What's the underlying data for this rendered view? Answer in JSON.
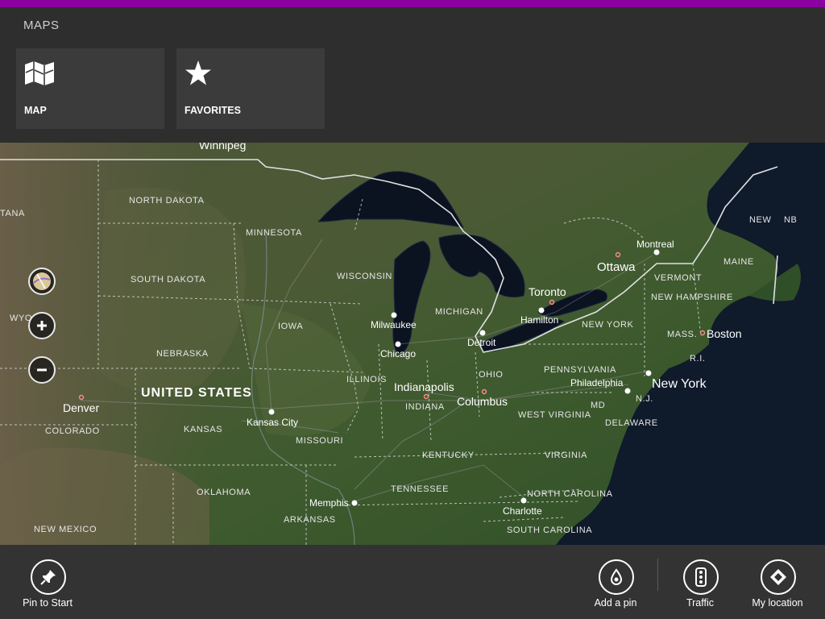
{
  "app": {
    "title": "MAPS",
    "accent_color": "#8b00a0"
  },
  "tiles": [
    {
      "label": "MAP",
      "icon": "map-icon"
    },
    {
      "label": "FAVORITES",
      "icon": "star-icon"
    }
  ],
  "map": {
    "controls": [
      {
        "name": "map-style-button",
        "icon": "road-map-icon"
      },
      {
        "name": "zoom-in-button",
        "icon": "plus-icon"
      },
      {
        "name": "zoom-out-button",
        "icon": "minus-icon"
      }
    ],
    "country_label": "UNITED STATES",
    "state_labels": [
      "NORTH DAKOTA",
      "MINNESOTA",
      "SOUTH DAKOTA",
      "WISCONSIN",
      "MICHIGAN",
      "IOWA",
      "NEBRASKA",
      "ILLINOIS",
      "INDIANA",
      "OHIO",
      "KANSAS",
      "MISSOURI",
      "KENTUCKY",
      "WEST VIRGINIA",
      "VIRGINIA",
      "PENNSYLVANIA",
      "NEW YORK",
      "VERMONT",
      "NEW HAMPSHIRE",
      "MAINE",
      "MASS.",
      "R.I.",
      "N.J.",
      "MD",
      "DELAWARE",
      "TENNESSEE",
      "NORTH CAROLINA",
      "SOUTH CAROLINA",
      "OKLAHOMA",
      "ARKANSAS",
      "COLORADO",
      "NEW MEXICO",
      "TANA",
      "WYO",
      "NEW",
      "NB"
    ],
    "city_labels": [
      "Winnipeg",
      "Milwaukee",
      "Chicago",
      "Detroit",
      "Hamilton",
      "Kansas City",
      "Memphis",
      "Charlotte",
      "Philadelphia",
      "Denver",
      "Indianapolis",
      "Columbus"
    ],
    "big_city_labels": [
      "Ottawa",
      "Montreal",
      "Toronto",
      "Boston",
      "New York"
    ]
  },
  "appbar": {
    "left": [
      {
        "label": "Pin to Start",
        "icon": "pin-icon"
      }
    ],
    "right": [
      {
        "label": "Add a pin",
        "icon": "drop-pin-icon"
      },
      {
        "label": "Traffic",
        "icon": "traffic-light-icon"
      },
      {
        "label": "My location",
        "icon": "location-diamond-icon"
      }
    ]
  }
}
